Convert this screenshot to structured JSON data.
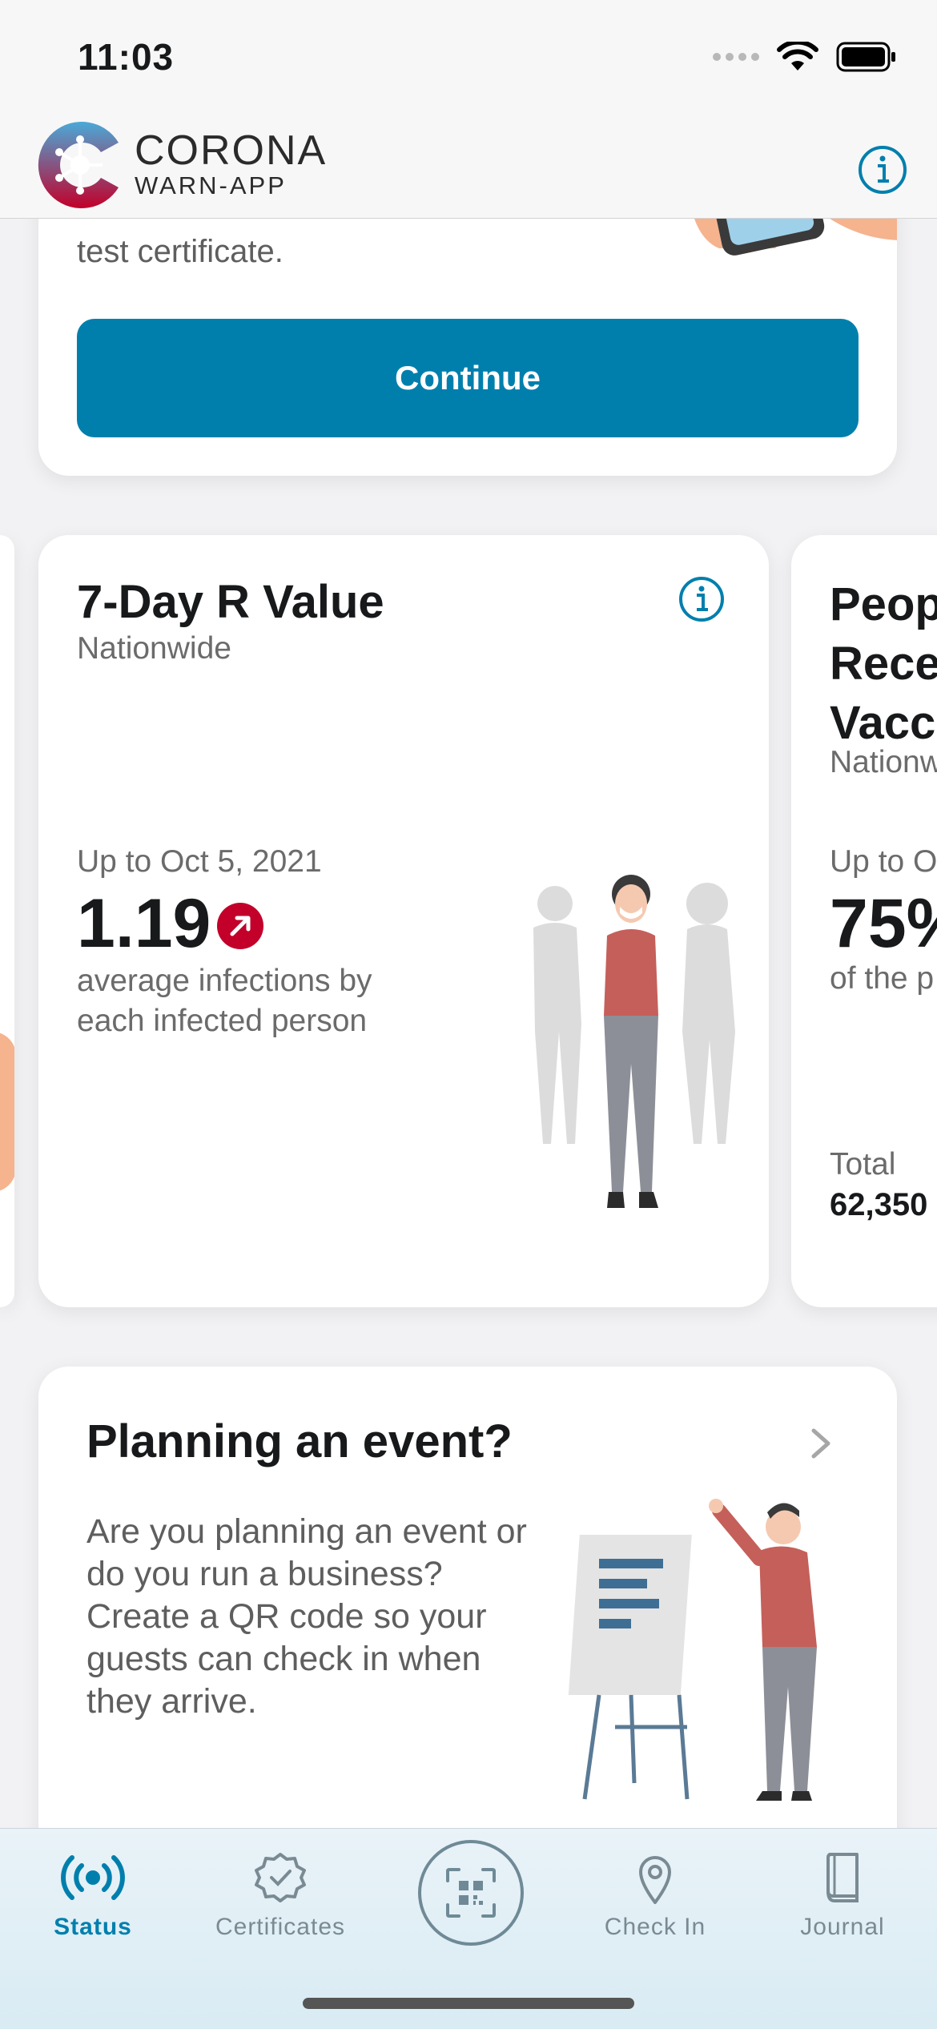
{
  "status_bar": {
    "time": "11:03"
  },
  "header": {
    "logo_title": "CORONA",
    "logo_subtitle": "WARN-APP"
  },
  "test_certificate_card": {
    "text": "test certificate.",
    "button_label": "Continue"
  },
  "r_value_card": {
    "title": "7-Day R Value",
    "subtitle": "Nationwide",
    "date": "Up to Oct 5, 2021",
    "value": "1.19",
    "description": "average infections by each infected person",
    "trend": "up"
  },
  "vaccination_card": {
    "title_lines": [
      "Peop",
      "Rece",
      "Vacc"
    ],
    "subtitle": "Nationw",
    "date": "Up to O",
    "value": "75%",
    "description": "of the p",
    "total_label": "Total",
    "total_value": "62,350"
  },
  "event_card": {
    "title": "Planning an event?",
    "description": "Are you planning an event or do you run a business? Create a QR code so your guests can check in when they arrive."
  },
  "tab_bar": {
    "tabs": [
      {
        "label": "Status",
        "icon": "broadcast-icon",
        "active": true
      },
      {
        "label": "Certificates",
        "icon": "certificate-badge-icon",
        "active": false
      },
      {
        "label": "",
        "icon": "qr-scan-icon",
        "active": false
      },
      {
        "label": "Check In",
        "icon": "location-pin-icon",
        "active": false
      },
      {
        "label": "Journal",
        "icon": "book-icon",
        "active": false
      }
    ]
  },
  "colors": {
    "accent": "#007fad",
    "trend_red": "#c2002a",
    "secondary_text": "#6b6b6b"
  }
}
